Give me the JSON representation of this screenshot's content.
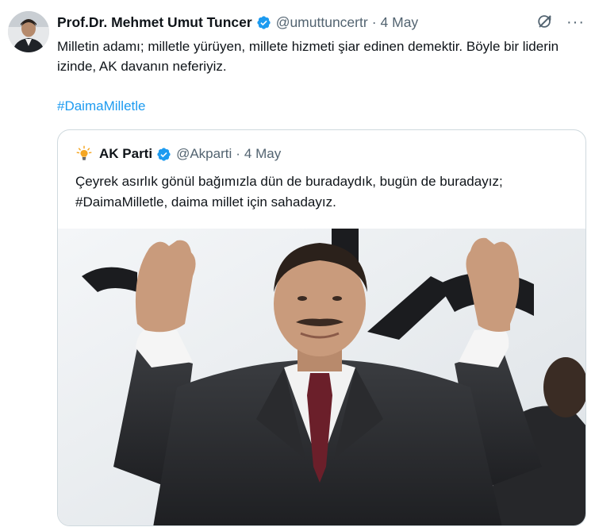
{
  "tweet": {
    "author": {
      "display_name": "Prof.Dr. Mehmet Umut Tuncer",
      "handle": "@umuttuncertr",
      "separator": "·",
      "date": "4 May",
      "avatar_icon": "avatar-photo"
    },
    "text": "Milletin adamı; milletle yürüyen, millete hizmeti şiar edinen demektir. Böyle bir liderin izinde, AK davanın neferiyiz.",
    "hashtag": "#DaimaMilletle",
    "icons": {
      "verified": "verified-badge-icon",
      "grok": "grok-icon",
      "more": "···"
    },
    "colors": {
      "link": "#1d9bf0",
      "secondary_text": "#536471",
      "verified": "#1d9bf0",
      "border": "#cfd9de"
    }
  },
  "quoted_tweet": {
    "author": {
      "display_name": "AK Parti",
      "handle": "@Akparti",
      "separator": "·",
      "date": "4 May",
      "logo_icon": "ak-parti-bulb-logo"
    },
    "text": "Çeyrek asırlık gönül bağımızla dün de buradaydık, bugün de buradayız; #DaimaMilletle, daima millet için sahadayız.",
    "media": {
      "type": "photo",
      "subject": "man in dark suit waving with both hands raised"
    }
  }
}
